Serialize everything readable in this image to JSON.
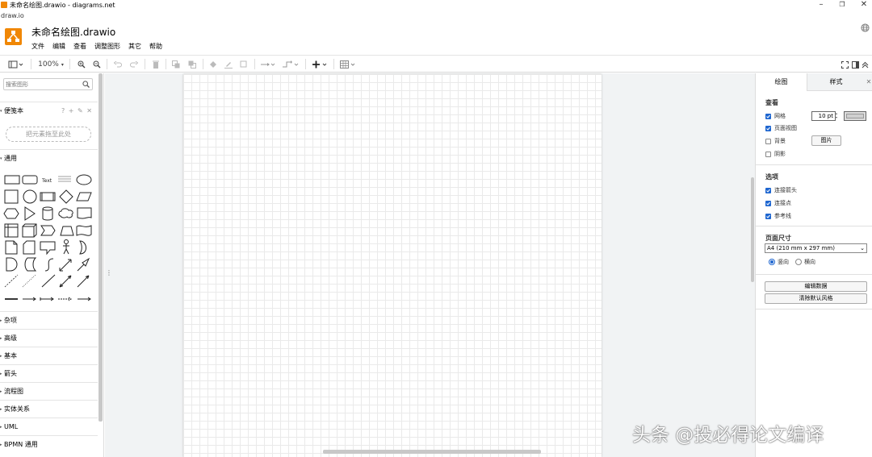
{
  "window": {
    "title": "未命名绘图.drawio - diagrams.net",
    "subtitle": "draw.io",
    "minimize": "–",
    "restore": "❐",
    "close": "✕"
  },
  "header": {
    "doc_title": "未命名绘图.drawio",
    "menus": [
      "文件",
      "编辑",
      "查看",
      "调整图形",
      "其它",
      "帮助"
    ]
  },
  "toolbar": {
    "zoom": "100%"
  },
  "sidebar": {
    "search_placeholder": "搜索图形",
    "scratchpad_label": "便笺本",
    "scratchpad_tools": "? + ✎ ✕",
    "dropzone_text": "把元素拖至此处",
    "general_label": "通用",
    "shape_text_label": "Text",
    "sections": [
      "杂项",
      "高级",
      "基本",
      "箭头",
      "流程图",
      "实体关系",
      "UML",
      "BPMN 通用"
    ]
  },
  "right_panel": {
    "tabs": [
      "绘图",
      "样式"
    ],
    "view_title": "查看",
    "grid_label": "网格",
    "grid_checked": true,
    "grid_size": "10 pt",
    "page_view_label": "页面视图",
    "page_view_checked": true,
    "background_label": "背景",
    "background_checked": false,
    "image_button": "图片",
    "shadow_label": "阴影",
    "shadow_checked": false,
    "options_title": "选项",
    "connection_arrows_label": "连接箭头",
    "connection_points_label": "连接点",
    "guides_label": "参考线",
    "page_size_title": "页面尺寸",
    "page_size_value": "A4 (210 mm x 297 mm)",
    "portrait_label": "竖向",
    "landscape_label": "横向",
    "orientation": "portrait",
    "edit_data_button": "编辑数据",
    "clear_style_button": "清除默认风格"
  },
  "watermark": "头条 @投必得论文编译",
  "colors": {
    "brand": "#f08705",
    "check_blue": "#1e66d0",
    "canvas_bg": "#f1f3f4"
  }
}
